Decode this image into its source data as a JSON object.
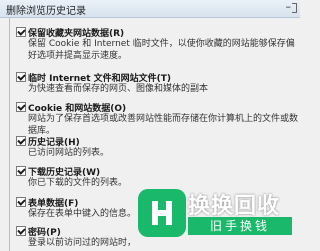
{
  "window": {
    "title": "删除浏览历史记录"
  },
  "options": [
    {
      "label": "保留收藏夹网站数据(R)",
      "checked": true,
      "desc": "保留 Cookie 和 Internet 临时文件，以使你收藏的网站能够保存偏好选项并提高显示速度。"
    },
    {
      "label": "临时 Internet 文件和网站文件(T)",
      "checked": true,
      "desc": "为快速查看而保存的网页、图像和媒体的副本"
    },
    {
      "label": "Cookie 和网站数据(O)",
      "checked": true,
      "desc": "网站为了保存首选项或改善网站性能而存储在你计算机上的文件或数据库。"
    },
    {
      "label": "历史记录(H)",
      "checked": true,
      "desc": "已访问网站的列表。"
    },
    {
      "label": "下载历史记录(W)",
      "checked": true,
      "desc": "你已下载的文件的列表。"
    },
    {
      "label": "表单数据(F)",
      "checked": true,
      "desc": "保存在表单中键入的信息。"
    },
    {
      "label": "密码(P)",
      "checked": true,
      "desc": "登录以前访问过的网站时，"
    }
  ],
  "watermark": {
    "brand": "换换回收",
    "sub": "旧手换钱",
    "brand_color": "#19b86a"
  }
}
